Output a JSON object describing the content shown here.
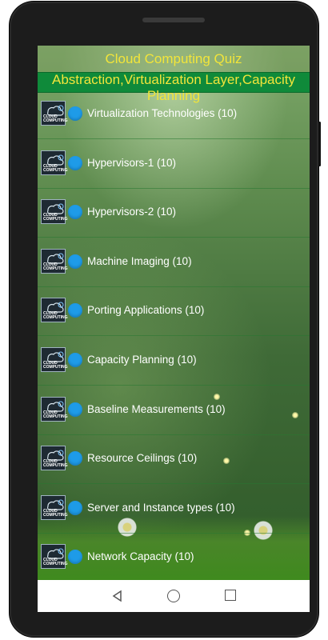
{
  "app": {
    "title": "Cloud Computing Quiz",
    "subtitle": "Abstraction,Virtualization Layer,Capacity Planning"
  },
  "thumbnail": {
    "line1": "CLOUD",
    "line2": "COMPUTING",
    "icon": "cloud-computing-thumbnail-icon"
  },
  "items": [
    {
      "label": "Virtualization Technologies (10)"
    },
    {
      "label": "Hypervisors-1 (10)"
    },
    {
      "label": "Hypervisors-2 (10)"
    },
    {
      "label": "Machine Imaging (10)"
    },
    {
      "label": "Porting Applications (10)"
    },
    {
      "label": "Capacity Planning (10)"
    },
    {
      "label": "Baseline Measurements  (10)"
    },
    {
      "label": "Resource Ceilings (10)"
    },
    {
      "label": "Server and Instance types (10)"
    },
    {
      "label": "Network Capacity (10)"
    }
  ],
  "colors": {
    "title_text": "#f2e53a",
    "subtitle_bar": "#0f8a3a",
    "dot": "#1e9be8",
    "item_text": "#ffffff"
  },
  "navbar": {
    "back_icon": "back-triangle-icon",
    "home_icon": "home-circle-icon",
    "recents_icon": "recents-square-icon"
  }
}
